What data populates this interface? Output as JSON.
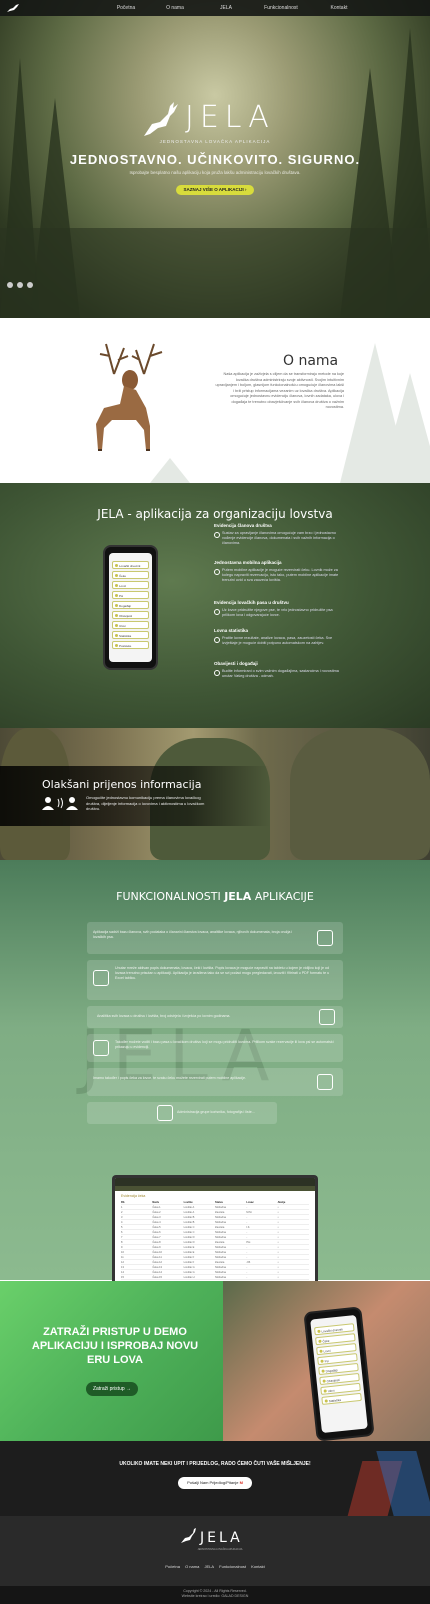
{
  "nav": {
    "links": [
      "Početna",
      "O nama",
      "JELA",
      "Funkcionalnost",
      "Kontakt"
    ]
  },
  "hero": {
    "logo": "JELA",
    "tagline": "JEDNOSTAVNA LOVAČKA APLIKACIJA",
    "title": "JEDNOSTAVNO.  UČINKOVITO.  SIGURNO.",
    "subtitle": "Isprobajte besplatno našu aplikaciju koja pruža lakšu administraciju lovačkih društava.",
    "button": "SAZNAJ VIŠE O APLIKACIJI  ›"
  },
  "about": {
    "title": "O nama",
    "text": "Naša aplikacija je zaživjela s ciljem da se transformiraju metode na koje lovačka društva administriraju svoje aktivnosti. Svojim intuitivnim upravljanjem i boljom, glasnijom funkcionalnošću omogućuje članovima lakši i brži pristup informacijama vezanim uz lovačka društva. Aplikacija omogućuje jednostavnu evidenciju članova, lovnih zadataka, ulova i događaja te trenutno obavješćivanje svih članova društva o važnim novostima."
  },
  "app": {
    "title": "JELA - aplikacija za organizaciju lovstva",
    "features": [
      {
        "heading": "Evidencija članova društva",
        "text": "Sustav za upravljanje članovima omogućuje vam brzo i jednostavno vođenje evidencije članova, dokumenata i svih važnih informacija o članovima."
      },
      {
        "heading": "Jednostavna mobilna aplikacija",
        "text": "Putem mobilne aplikacije je moguće rezervirati čeku. Lovnik može za kolegu napraviti rezervaciju, isto tako, putem mobilne aplikacije imate trenutni uvid u sva zauzeća lovišta."
      },
      {
        "heading": "Evidencija lovačkih pasa u društvu",
        "text": "Uz lovce pridružite njegove pse, te vrlo jednostavno pridružite psa prilikom lova i odgovarajuće lovce."
      },
      {
        "heading": "Lovna statistika",
        "text": "Pratite lovne rezultate, analize lovaca, pasa, zauzetosti čeka. Sve izvještaje je moguće dobiti potpuno automatskom na zahtjev."
      },
      {
        "heading": "Obavijesti i događaji",
        "text": "Budite informirani o svim važnim događajima, sastancima i novostima unutar Vašeg društva - odmah."
      }
    ],
    "phone_items": [
      "Lovački dnevnik",
      "Čeke",
      "Lovci",
      "Psi",
      "Događaji",
      "Obavijesti",
      "Ulovi",
      "Statistika",
      "Postavke"
    ]
  },
  "hunters": {
    "title": "Olakšani prijenos informacija",
    "text": "Omogućite jednostavnu komunikaciju prema članovima lovačkog društva, dijeljenje informacija o lovovima i aktivnostima u lovačkom društvu."
  },
  "func": {
    "title_pre": "FUNKCIONALNOSTI ",
    "title_bold": "JELA",
    "title_post": " APLIKACIJE",
    "watermark": "JELA",
    "cards": [
      "Aplikacija sadrži bazu članova, svih podataka o članarini članstva lovaca, analitike lovaca, njihovih dokumenata, broja oružja i lovačkih psa.",
      "Unutar mreže aktivan popis dokumenata, lovaca, čeki i lovišta. Popis lovaca je moguće napraviti na tabletu u kojem je vidljivo koji je od lovaca trenutno prisutan u aplikaciji. Aplikacija je izrađena tako da se svi podaci mogu pregledavati, izvoziti i filtrirati u PDF formatu te u Excel tablicu.",
      "Analitika svih lovaca u društvu i lovišta, broj odstrjela i izvješća po lovnim godinama.",
      "Također možete voditi i bazu pasa u lovačkom društvu koji se mogu pridružiti lovcima. Prilikom svake rezervacije ili lova psi se automatski prikazuju u evidenciji.",
      "Imamo također i popis čeka za lovce, te svaku čeku možete rezervirati putem mobilne aplikacije.",
      "Administracija grupe korisnika, fotografija i liste..."
    ],
    "laptop_title": "Evidencija čeka",
    "table_head": [
      "Rb",
      "Naziv",
      "Lovište",
      "Status",
      "Lovac",
      "Akcije"
    ],
    "table_rows": [
      [
        "1",
        "Čeka 1",
        "Lovište A",
        "Slobodna",
        "-",
        "•"
      ],
      [
        "2",
        "Čeka 2",
        "Lovište A",
        "Zauzeta",
        "M.M.",
        "•"
      ],
      [
        "3",
        "Čeka 3",
        "Lovište B",
        "Slobodna",
        "-",
        "•"
      ],
      [
        "4",
        "Čeka 4",
        "Lovište B",
        "Slobodna",
        "-",
        "•"
      ],
      [
        "5",
        "Čeka 5",
        "Lovište C",
        "Zauzeta",
        "I.K.",
        "•"
      ],
      [
        "6",
        "Čeka 6",
        "Lovište C",
        "Slobodna",
        "-",
        "•"
      ],
      [
        "7",
        "Čeka 7",
        "Lovište D",
        "Slobodna",
        "-",
        "•"
      ],
      [
        "8",
        "Čeka 8",
        "Lovište D",
        "Zauzeta",
        "P.H.",
        "•"
      ],
      [
        "9",
        "Čeka 9",
        "Lovište E",
        "Slobodna",
        "-",
        "•"
      ],
      [
        "10",
        "Čeka 10",
        "Lovište E",
        "Slobodna",
        "-",
        "•"
      ],
      [
        "11",
        "Čeka 11",
        "Lovište F",
        "Slobodna",
        "-",
        "•"
      ],
      [
        "12",
        "Čeka 12",
        "Lovište F",
        "Zauzeta",
        "J.B.",
        "•"
      ],
      [
        "13",
        "Čeka 13",
        "Lovište G",
        "Slobodna",
        "-",
        "•"
      ],
      [
        "14",
        "Čeka 14",
        "Lovište G",
        "Slobodna",
        "-",
        "•"
      ],
      [
        "15",
        "Čeka 15",
        "Lovište H",
        "Slobodna",
        "-",
        "•"
      ]
    ]
  },
  "cta": {
    "title": "ZATRAŽI PRISTUP U DEMO APLIKACIJU I ISPROBAJ NOVU ERU LOVA",
    "button": "Zatraži pristup  →"
  },
  "feedback": {
    "text": "UKOLIKO IMATE NEKI UPIT I PRIJEDLOG, RADO ĆEMO ČUTI VAŠE MIŠLJENJE!",
    "button": "Pošalji Nam Prijedlog/Pitanje"
  },
  "footer": {
    "logo": "JELA",
    "tagline": "JEDNOSTAVNA LOVAČKA APLIKACIJA",
    "links": [
      "Početna",
      "O nama",
      "JELA",
      "Funkcionalnost",
      "Kontakt"
    ],
    "copyright": "Copyright © 2024 - All Rights Reserved.",
    "credit": "Website kreirao i uredio: GALAD DESIGN"
  },
  "colors": {
    "accent": "#d8dc3c",
    "dark_green": "#3f5635",
    "cta_green": "#4fb25a"
  }
}
